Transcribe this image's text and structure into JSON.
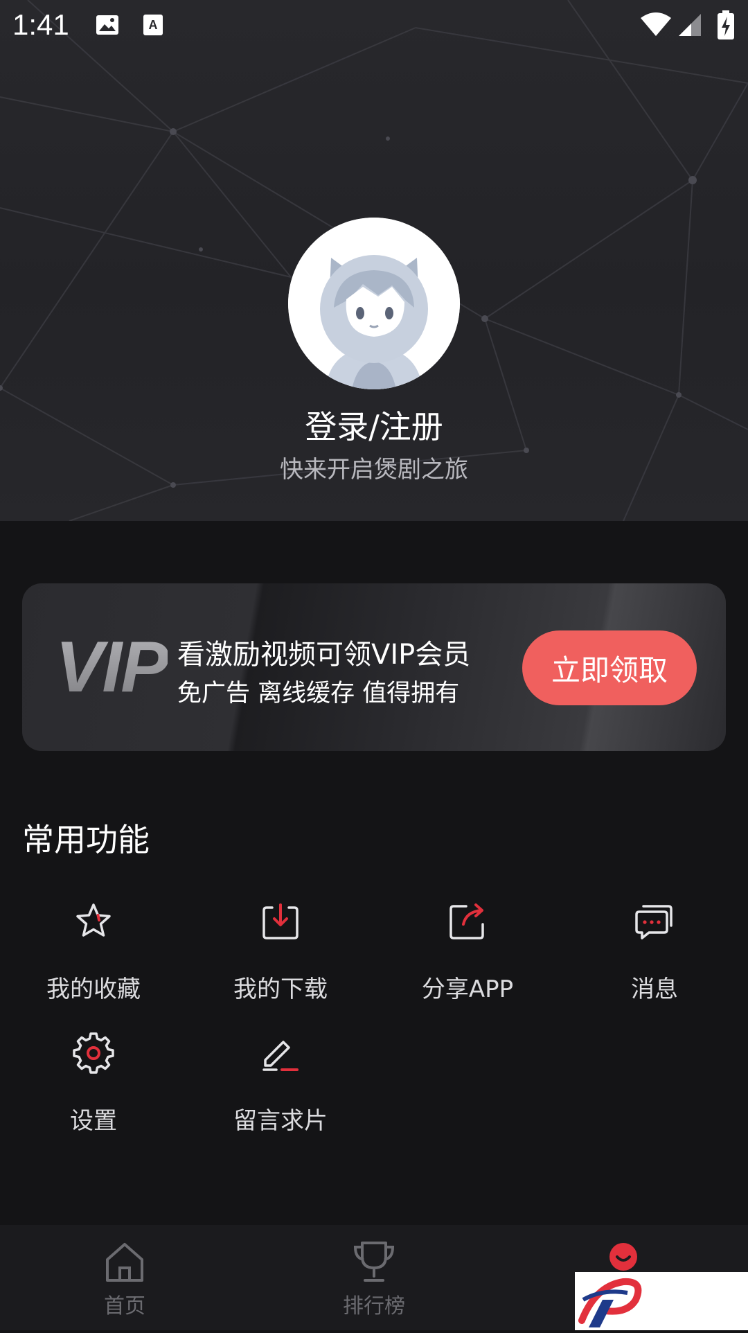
{
  "status_bar": {
    "time": "1:41"
  },
  "profile": {
    "login_label": "登录/注册",
    "subtitle": "快来开启煲剧之旅"
  },
  "vip_card": {
    "logo_text": "VIP",
    "title": "看激励视频可领VIP会员",
    "subtitle": "免广告 离线缓存 值得拥有",
    "button_label": "立即领取",
    "button_color": "#f0605e"
  },
  "features": {
    "section_title": "常用功能",
    "items": [
      {
        "label": "我的收藏",
        "icon": "star-icon"
      },
      {
        "label": "我的下载",
        "icon": "download-icon"
      },
      {
        "label": "分享APP",
        "icon": "share-icon"
      },
      {
        "label": "消息",
        "icon": "message-icon"
      },
      {
        "label": "设置",
        "icon": "gear-icon"
      },
      {
        "label": "留言求片",
        "icon": "edit-icon"
      }
    ],
    "accent_color": "#e2303c"
  },
  "bottom_nav": {
    "items": [
      {
        "label": "首页",
        "icon": "home-icon"
      },
      {
        "label": "排行榜",
        "icon": "trophy-icon"
      },
      {
        "label": "",
        "icon": "profile-icon",
        "active": true
      }
    ]
  }
}
